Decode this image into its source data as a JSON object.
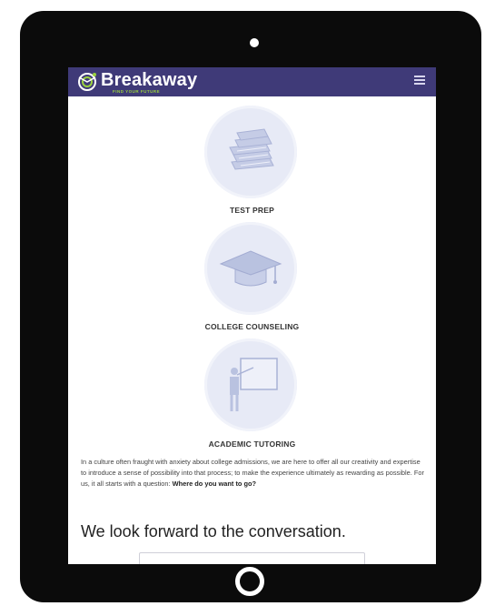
{
  "brand": {
    "name": "Breakaway",
    "tagline": "FIND YOUR FUTURE",
    "accent": "#9ad13f",
    "nav_color": "#3f3a78"
  },
  "services": [
    {
      "label": "TEST PREP",
      "icon": "books-icon"
    },
    {
      "label": "COLLEGE COUNSELING",
      "icon": "graduation-cap-icon"
    },
    {
      "label": "ACADEMIC TUTORING",
      "icon": "teacher-board-icon"
    }
  ],
  "intro": {
    "text": "In a culture often fraught with anxiety about college admissions, we are here to offer all our creativity and expertise to introduce a sense of possibility into that process; to make the experience ultimately as rewarding as possible. For us, it all starts with a question: ",
    "question": "Where do you want to go?"
  },
  "cta": {
    "heading": "We look forward to the conversation."
  }
}
